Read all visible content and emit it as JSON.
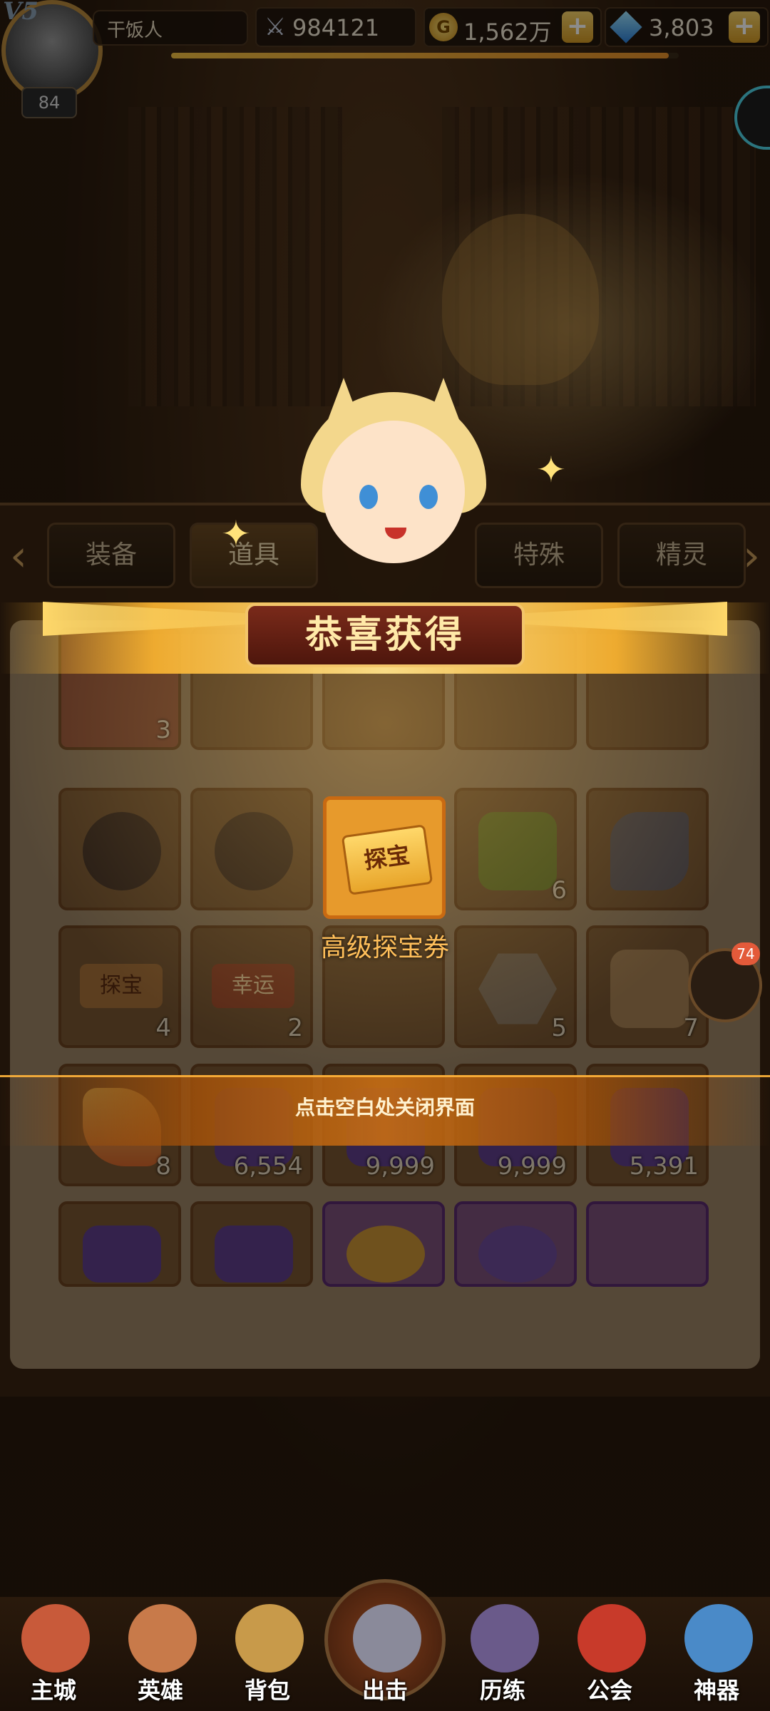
{
  "player": {
    "vip": "V5",
    "level": "84",
    "name": "干饭人"
  },
  "resources": {
    "power": "984121",
    "gold": "1,562万",
    "gems": "3,803"
  },
  "tabs": [
    "装备",
    "道具",
    "特殊",
    "精灵"
  ],
  "reward": {
    "title": "恭喜获得",
    "item_name": "高级探宝券",
    "ticket_text": "探宝",
    "close_hint": "点击空白处关闭界面"
  },
  "inventory": {
    "row1": [
      "3",
      "",
      "",
      "",
      ""
    ],
    "row2": [
      "",
      "",
      "",
      "6",
      ""
    ],
    "row3": [
      "4",
      "2",
      "",
      "5",
      "7"
    ],
    "row4": [
      "8",
      "6,554",
      "9,999",
      "9,999",
      "5,391"
    ],
    "row3_tags": [
      "探宝",
      "幸运"
    ]
  },
  "chat": {
    "badge": "74"
  },
  "nav": [
    "主城",
    "英雄",
    "背包",
    "出击",
    "历练",
    "公会",
    "神器"
  ],
  "colors": {
    "accent": "#ffd86a",
    "banner": "#7a2a1a",
    "reward_label": "#ffbf5a"
  }
}
